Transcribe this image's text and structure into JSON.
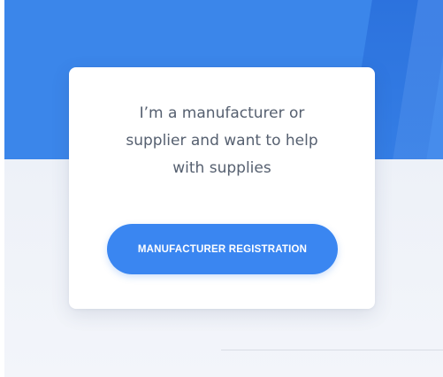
{
  "card": {
    "lines": [
      "I’m a manufacturer or",
      "supplier and want to help",
      "with supplies"
    ],
    "button_label": "MANUFACTURER REGISTRATION"
  },
  "colors": {
    "hero_blue": "#3b86ea",
    "button_blue": "#3a86f1",
    "text_gray": "#566070",
    "background_gray": "#eef2f8"
  }
}
